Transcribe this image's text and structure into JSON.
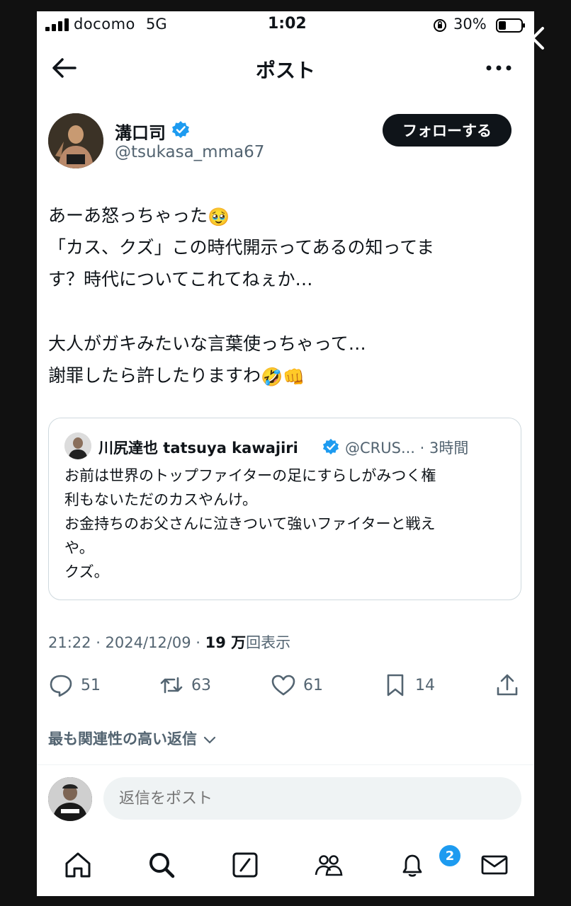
{
  "status_bar": {
    "carrier": "docomo",
    "network": "5G",
    "time": "1:02",
    "battery": "30%"
  },
  "header": {
    "title": "ポスト"
  },
  "author": {
    "name": "溝口司",
    "handle": "@tsukasa_mma67",
    "follow_label": "フォローする"
  },
  "post": {
    "lines": [
      "あーあ怒っちゃった",
      "「カス、クズ」この時代開示ってあるの知ってま",
      "す？時代についてこれてねぇか…",
      "大人がガキみたいな言葉使っちゃって…",
      "謝罪したら許したりますわ"
    ],
    "emoji1": "🥹",
    "emoji2": "🤣👊"
  },
  "quote": {
    "name": "川尻達也 tatsuya kawajiri",
    "handle": "@CRUS... · 3時間",
    "lines": [
      "お前は世界のトップファイターの足にすらしがみつく権",
      "利もないただのカスやんけ。",
      "お金持ちのお父さんに泣きついて強いファイターと戦え",
      "や。",
      "クズ。"
    ]
  },
  "meta": {
    "timestamp": "21:22 · 2024/12/09 · ",
    "views_count": "19 万",
    "views_label": "回表示"
  },
  "actions": {
    "replies": "51",
    "reposts": "63",
    "likes": "61",
    "bookmarks": "14"
  },
  "related_label": "最も関連性の高い返信",
  "reply_box": {
    "placeholder": "返信をポスト"
  },
  "notifications_badge": "2",
  "colors": {
    "accent": "#1d9bf0",
    "text": "#0f1419",
    "muted": "#536471"
  }
}
